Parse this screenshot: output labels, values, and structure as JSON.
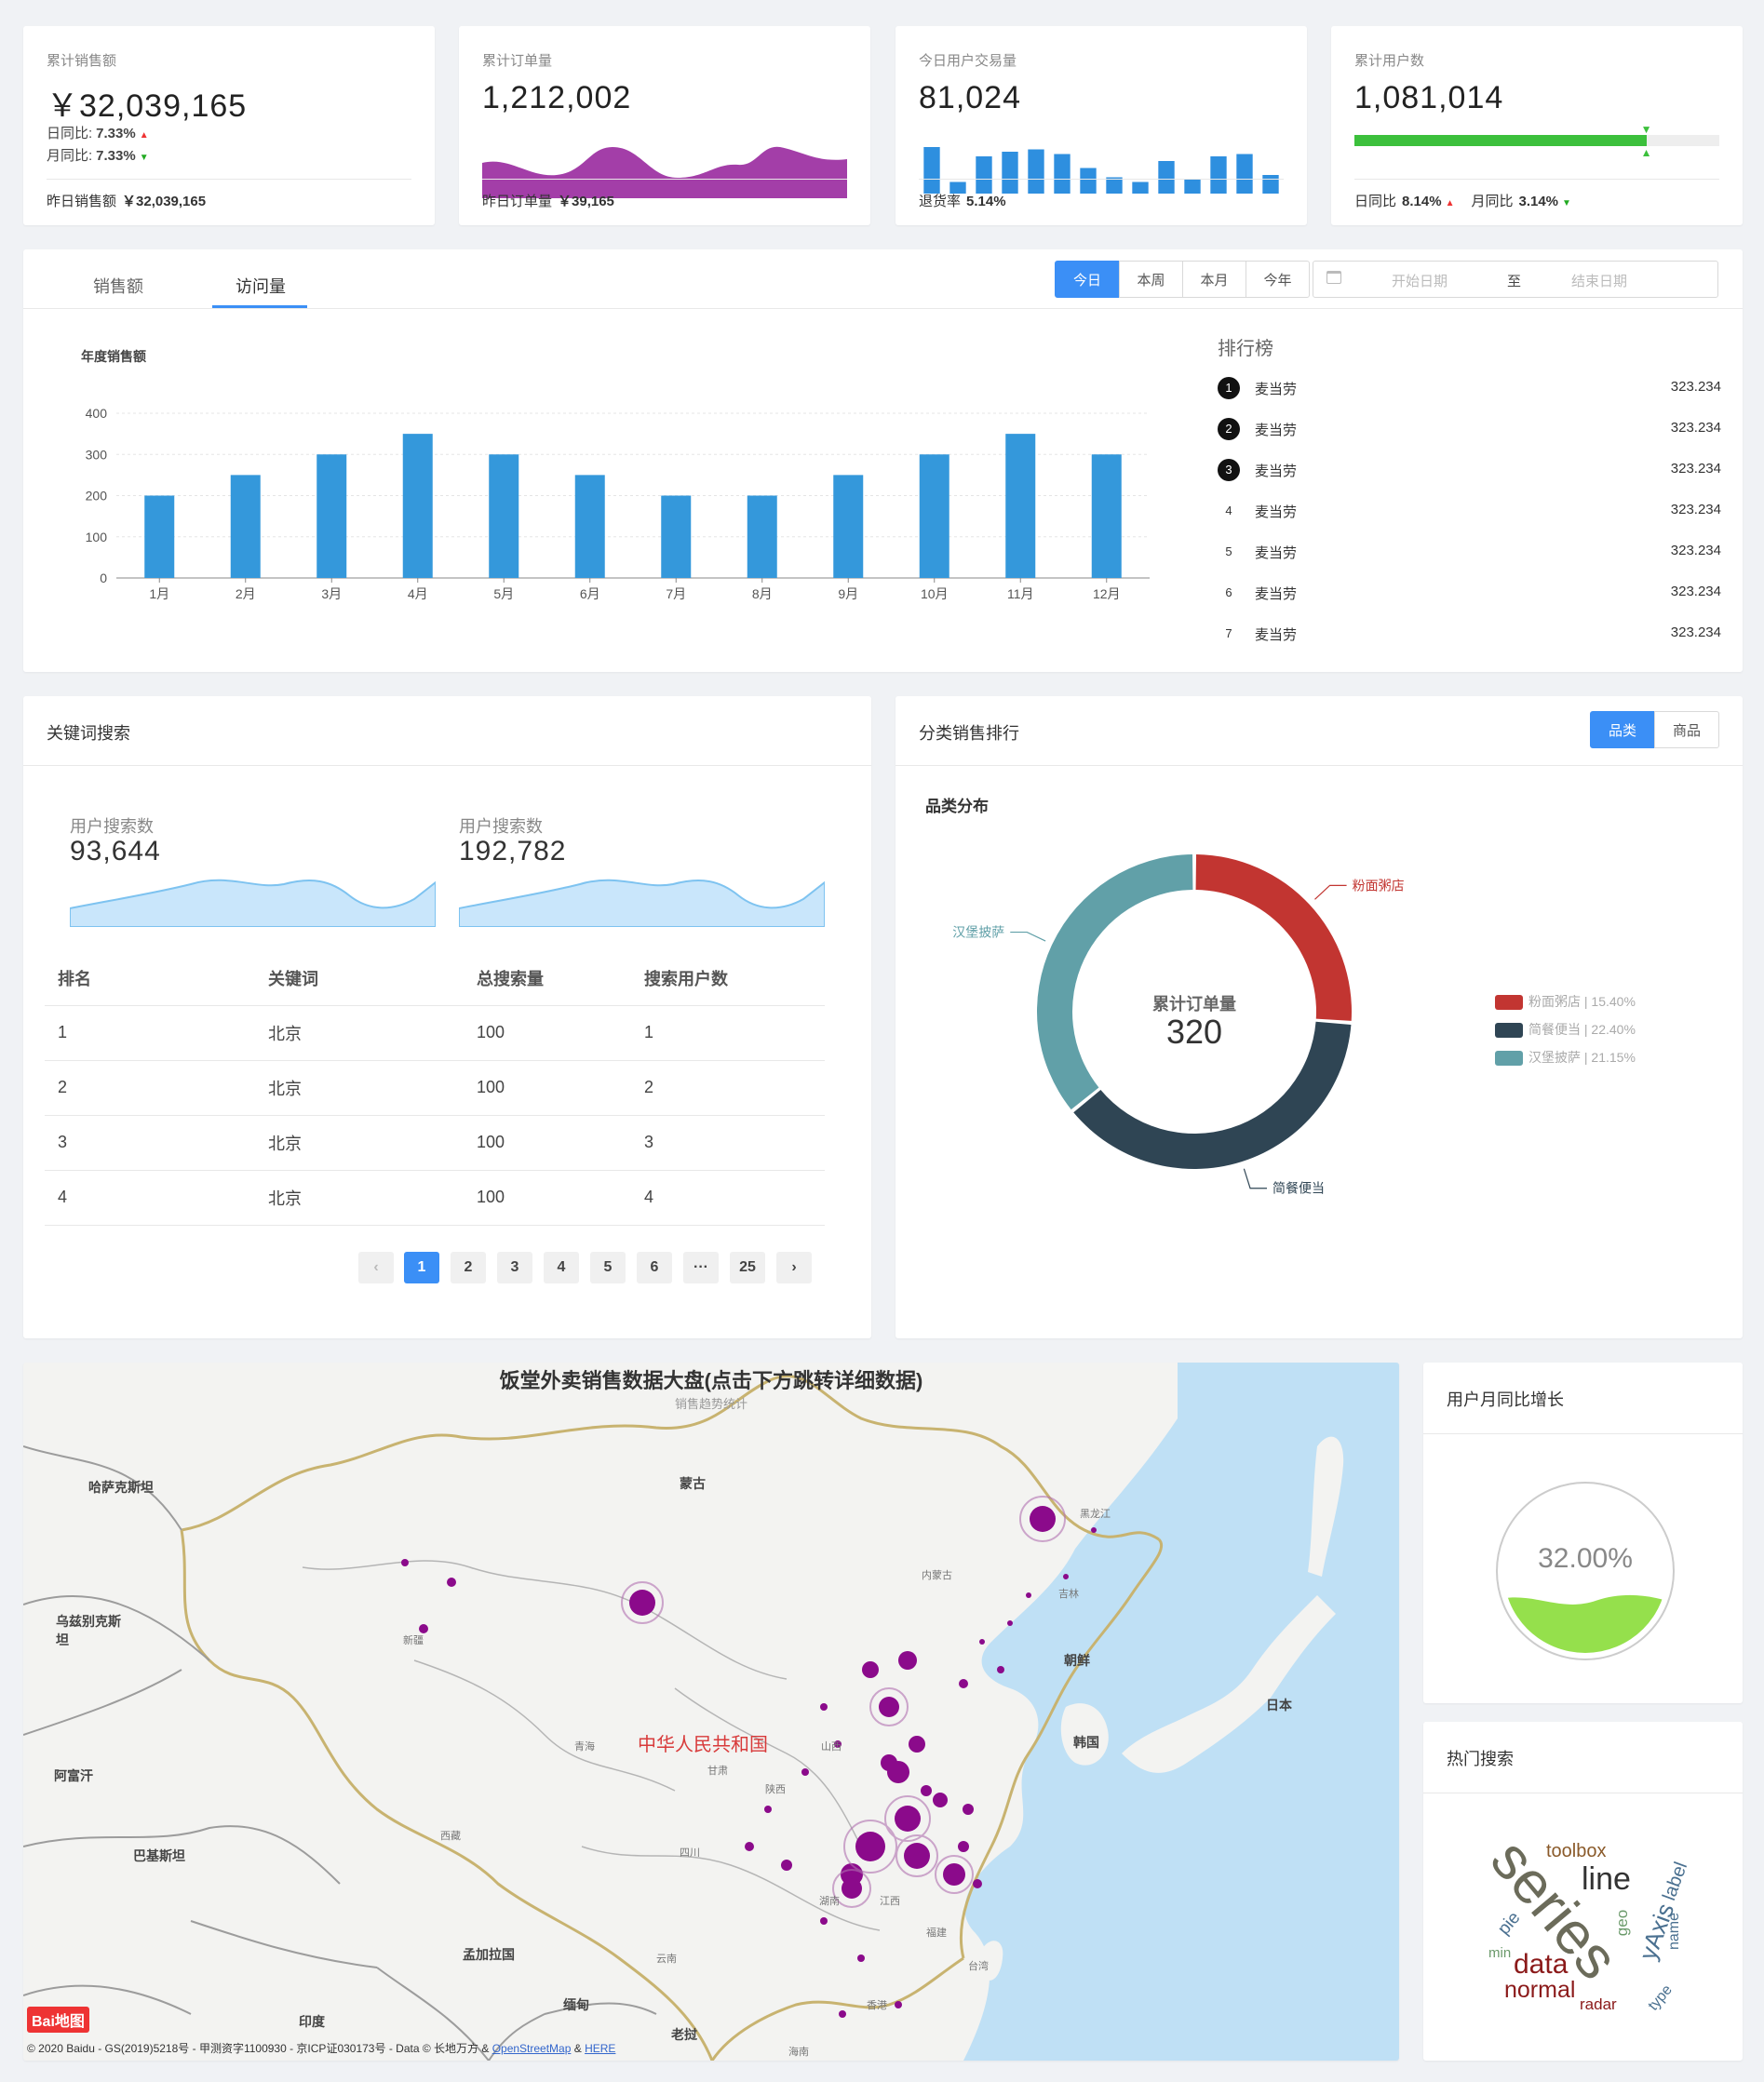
{
  "stats": [
    {
      "label": "累计销售额",
      "value": "￥32,039,165",
      "day_label": "日同比:",
      "day_value": "7.33%",
      "month_label": "月同比:",
      "month_value": "7.33%",
      "foot_label": "昨日销售额",
      "foot_value": "￥32,039,165"
    },
    {
      "label": "累计订单量",
      "value": "1,212,002",
      "foot_label": "昨日订单量",
      "foot_value": "￥39,165"
    },
    {
      "label": "今日用户交易量",
      "value": "81,024",
      "foot_label": "退货率",
      "foot_value": "5.14%",
      "mini_bars": [
        1.0,
        0.25,
        0.8,
        0.9,
        0.95,
        0.85,
        0.55,
        0.35,
        0.25,
        0.7,
        0.3,
        0.8,
        0.85,
        0.4
      ]
    },
    {
      "label": "累计用户数",
      "value": "1,081,014",
      "progress": 0.8,
      "day_label": "日同比",
      "day_value": "8.14%",
      "month_label": "月同比",
      "month_value": "3.14%"
    }
  ],
  "sales_panel": {
    "tabs": [
      "销售额",
      "访问量"
    ],
    "active_tab": 1,
    "ranges": [
      "今日",
      "本周",
      "本月",
      "今年"
    ],
    "active_range": 0,
    "date_start_placeholder": "开始日期",
    "date_sep": "至",
    "date_end_placeholder": "结束日期",
    "chart_title": "年度销售额",
    "ranking_title": "排行榜",
    "ranking": [
      {
        "rank": "1",
        "name": "麦当劳",
        "value": "323.234"
      },
      {
        "rank": "2",
        "name": "麦当劳",
        "value": "323.234"
      },
      {
        "rank": "3",
        "name": "麦当劳",
        "value": "323.234"
      },
      {
        "rank": "4",
        "name": "麦当劳",
        "value": "323.234"
      },
      {
        "rank": "5",
        "name": "麦当劳",
        "value": "323.234"
      },
      {
        "rank": "6",
        "name": "麦当劳",
        "value": "323.234"
      },
      {
        "rank": "7",
        "name": "麦当劳",
        "value": "323.234"
      }
    ]
  },
  "chart_data": [
    {
      "type": "bar",
      "title": "年度销售额",
      "categories": [
        "1月",
        "2月",
        "3月",
        "4月",
        "5月",
        "6月",
        "7月",
        "8月",
        "9月",
        "10月",
        "11月",
        "12月"
      ],
      "values": [
        200,
        250,
        300,
        350,
        300,
        250,
        200,
        200,
        250,
        300,
        350,
        300
      ],
      "ylim": [
        0,
        400
      ],
      "yticks": [
        "0",
        "100",
        "200",
        "300",
        "400"
      ],
      "grid": true,
      "color": "#3498db"
    },
    {
      "type": "pie",
      "title": "品类分布",
      "center_label": "累计订单量",
      "center_value": "320",
      "slices": [
        {
          "name": "粉面粥店",
          "value": 15.4,
          "legend": "粉面粥店 | 15.40%",
          "color": "#c23531"
        },
        {
          "name": "简餐便当",
          "value": 22.4,
          "legend": "简餐便当 | 22.40%",
          "color": "#2f4554"
        },
        {
          "name": "汉堡披萨",
          "value": 21.15,
          "legend": "汉堡披萨 | 21.15%",
          "color": "#61a0a8"
        }
      ]
    }
  ],
  "keyword": {
    "title": "关键词搜索",
    "metric1_label": "用户搜索数",
    "metric1_value": "93,644",
    "metric2_label": "用户搜索数",
    "metric2_value": "192,782",
    "headers": [
      "排名",
      "关键词",
      "总搜索量",
      "搜索用户数"
    ],
    "rows": [
      [
        "1",
        "北京",
        "100",
        "1"
      ],
      [
        "2",
        "北京",
        "100",
        "2"
      ],
      [
        "3",
        "北京",
        "100",
        "3"
      ],
      [
        "4",
        "北京",
        "100",
        "4"
      ]
    ],
    "pages": [
      "1",
      "2",
      "3",
      "4",
      "5",
      "6",
      "···",
      "25"
    ],
    "prev": "‹",
    "next": "›"
  },
  "category": {
    "title": "分类销售排行",
    "toggle": [
      "品类",
      "商品"
    ]
  },
  "map": {
    "title": "饭堂外卖销售数据大盘(点击下方跳转详细数据)",
    "subtitle": "销售趋势统计",
    "country_label": "中华人民共和国",
    "labels": [
      "哈萨克斯坦",
      "蒙古",
      "乌兹别克斯坦",
      "阿富汗",
      "巴基斯坦",
      "印度",
      "孟加拉国",
      "缅甸",
      "老挝",
      "朝鲜",
      "韩国",
      "日本",
      "新疆",
      "西藏",
      "青海",
      "甘肃",
      "四川",
      "云南",
      "湖南",
      "江西",
      "福建",
      "台湾",
      "内蒙古",
      "黑龙江",
      "吉林",
      "陕西",
      "山西",
      "海南",
      "香港"
    ],
    "logo": "Bai地图",
    "copyright_prefix": "© 2020 Baidu - GS(2019)5218号 - 甲测资字1100930 - 京ICP证030173号 - Data © 长地万方 & ",
    "osm_link": "OpenStreetMap",
    "amp": " & ",
    "here_link": "HERE"
  },
  "growth": {
    "title": "用户月同比增长",
    "value": "32.00%",
    "level": 0.32
  },
  "hot": {
    "title": "热门搜索",
    "words": [
      "series",
      "line",
      "toolbox",
      "label",
      "data",
      "normal",
      "yAxis",
      "name",
      "geo",
      "pie",
      "type",
      "radar",
      "min"
    ]
  }
}
